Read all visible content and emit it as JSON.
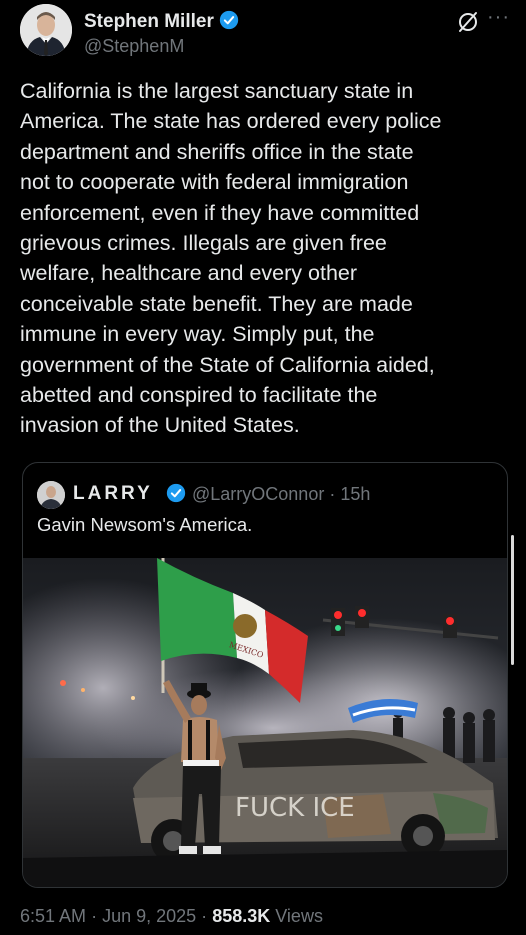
{
  "author": {
    "name": "Stephen Miller",
    "handle": "@StephenM"
  },
  "tweet": {
    "text": "California is the largest sanctuary state in\nAmerica. The state has ordered every police\ndepartment and sheriffs office in the state\nnot to cooperate with federal immigration\nenforcement, even if they have committed\ngrievous crimes. Illegals are given free\nwelfare, healthcare and every other\nconceivable state benefit. They are made\nimmune in every way. Simply put, the\ngovernment of the State of California aided,\nabetted and conspired to facilitate the\ninvasion of the United States."
  },
  "quoted": {
    "name": "LARRY",
    "handle": "@LarryOConnor",
    "time": "15h",
    "separator": "·",
    "text": "Gavin Newsom's America.",
    "image": {
      "flag_text": "MEXICO",
      "car_graffiti": "FUCK ICE"
    }
  },
  "footer": {
    "time": "6:51 AM",
    "date": "Jun 9, 2025",
    "separator": "·",
    "views_count": "858.3K",
    "views_label": "Views"
  },
  "colors": {
    "verified": "#1d9bf0",
    "muted": "#71767b",
    "text": "#e7e9ea"
  },
  "icons": [
    "verified-badge-icon",
    "grok-icon",
    "more-icon"
  ]
}
